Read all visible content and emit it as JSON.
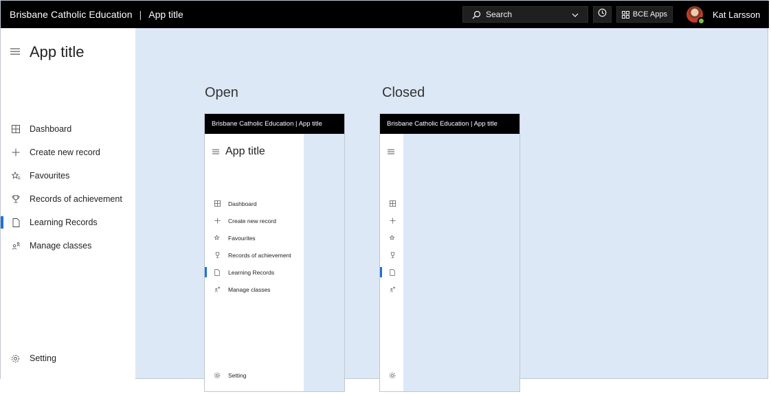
{
  "header": {
    "brand": "Brisbane Catholic Education",
    "separator": "|",
    "app_title": "App title",
    "search_label": "Search",
    "apps_label": "BCE Apps",
    "user_name": "Kat Larsson"
  },
  "sidebar": {
    "title": "App title",
    "items": [
      {
        "label": "Dashboard",
        "icon": "dashboard-icon"
      },
      {
        "label": "Create new record",
        "icon": "plus-icon"
      },
      {
        "label": "Favourites",
        "icon": "star-list-icon"
      },
      {
        "label": "Records of achievement",
        "icon": "trophy-icon"
      },
      {
        "label": "Learning Records",
        "icon": "document-icon",
        "active": true
      },
      {
        "label": "Manage classes",
        "icon": "people-icon"
      }
    ],
    "setting_label": "Setting"
  },
  "examples": {
    "open_label": "Open",
    "closed_label": "Closed",
    "open": {
      "bar_text": "Brisbane Catholic Education  |  App title",
      "title": "App title",
      "items": [
        "Dashboard",
        "Create new record",
        "Favourites",
        "Records of achievement",
        "Learning Records",
        "Manage classes"
      ],
      "setting_label": "Setting"
    },
    "closed": {
      "bar_text": "Brisbane Catholic Education  |  App title"
    }
  },
  "colors": {
    "topbar": "#000000",
    "content_bg": "#dce8f6",
    "active_indicator": "#1e73d6",
    "presence": "#7ac142"
  }
}
